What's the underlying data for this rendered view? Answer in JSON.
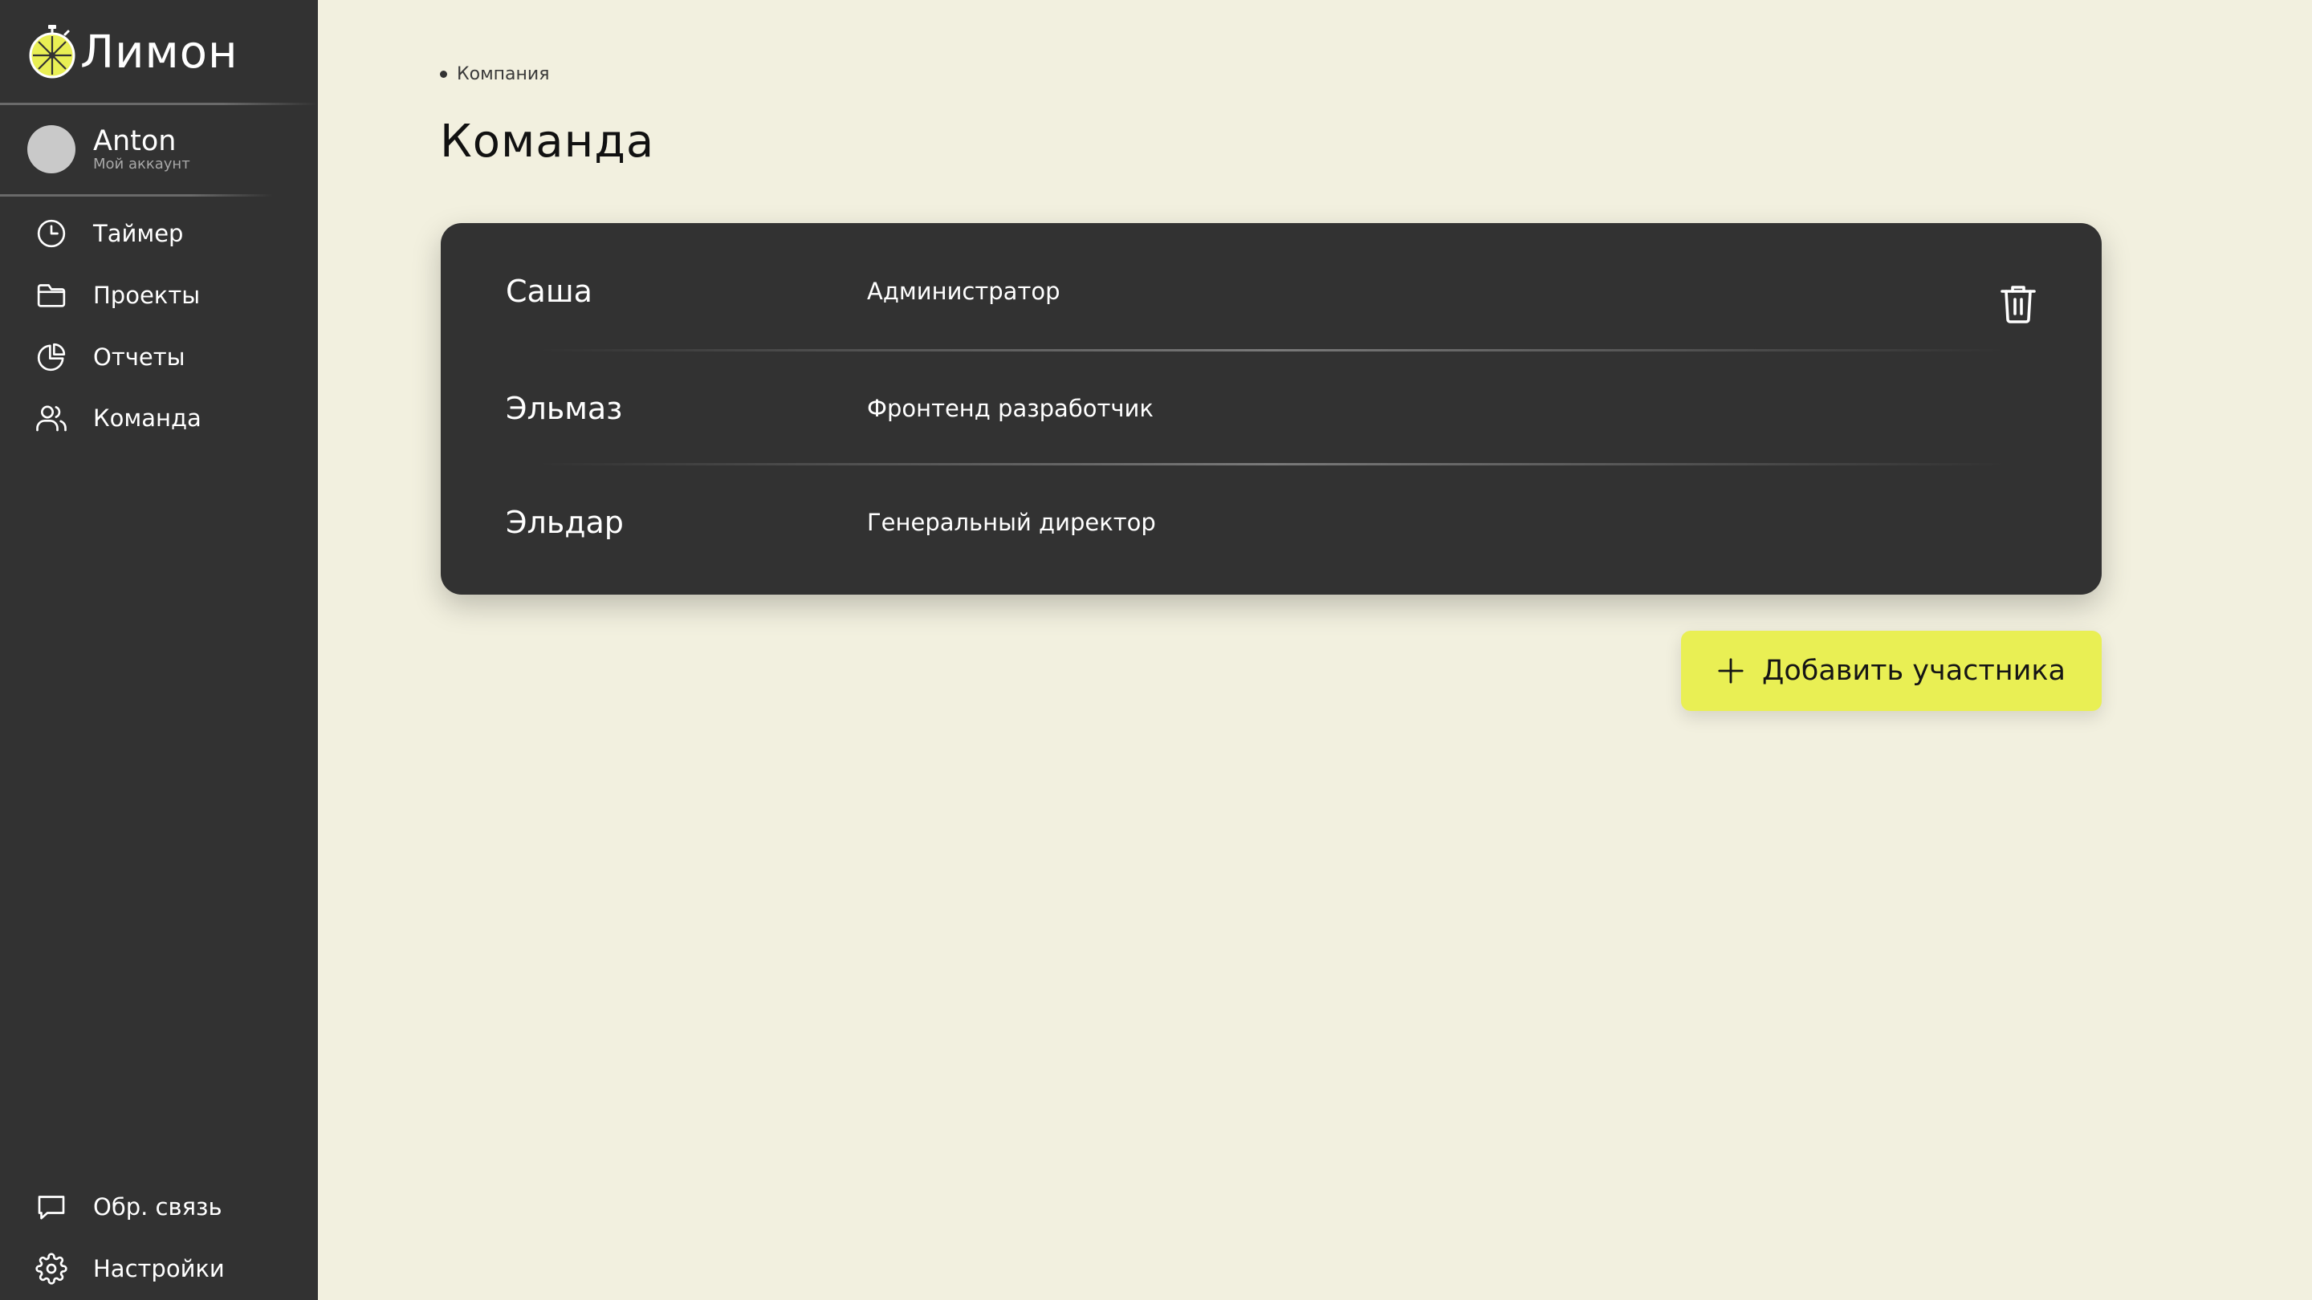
{
  "app": {
    "name": "Лимон"
  },
  "account": {
    "name": "Anton",
    "subtitle": "Мой аккаунт"
  },
  "sidebar": {
    "items": [
      {
        "label": "Таймер",
        "icon": "clock-icon"
      },
      {
        "label": "Проекты",
        "icon": "folder-icon"
      },
      {
        "label": "Отчеты",
        "icon": "pie-chart-icon"
      },
      {
        "label": "Команда",
        "icon": "users-icon"
      }
    ],
    "bottom_items": [
      {
        "label": "Обр. связь",
        "icon": "chat-icon"
      },
      {
        "label": "Настройки",
        "icon": "gear-icon"
      }
    ]
  },
  "breadcrumb": {
    "label": "Компания"
  },
  "page": {
    "title": "Команда"
  },
  "team": {
    "members": [
      {
        "name": "Саша",
        "role": "Администратор"
      },
      {
        "name": "Эльмаз",
        "role": "Фронтенд разработчик"
      },
      {
        "name": "Эльдар",
        "role": "Генеральный директор"
      }
    ]
  },
  "actions": {
    "add_member": "Добавить участника"
  },
  "colors": {
    "background": "#f2f0df",
    "sidebar": "#323232",
    "card": "#323232",
    "accent": "#e9ef54"
  }
}
